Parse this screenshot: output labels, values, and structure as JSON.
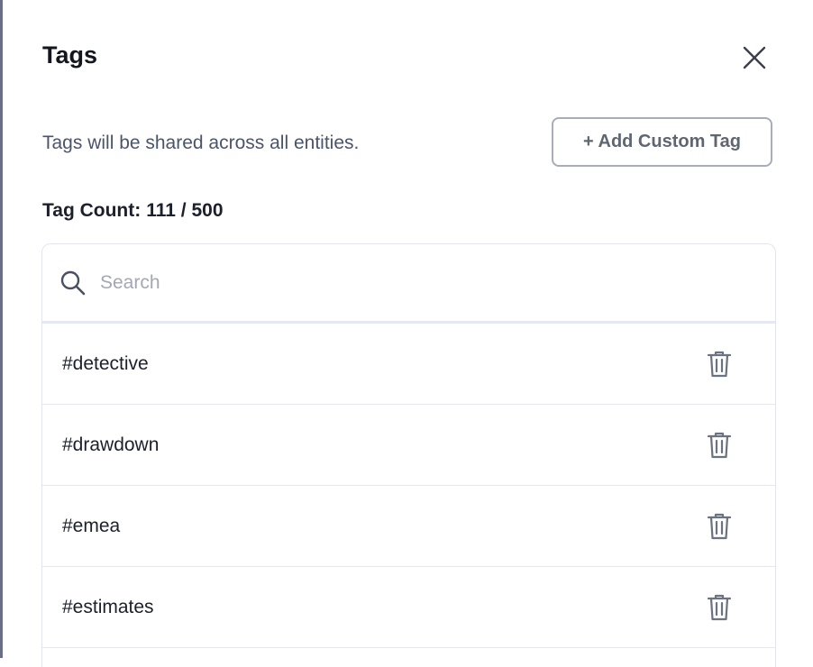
{
  "header": {
    "title": "Tags",
    "close_icon": "close-icon"
  },
  "subtitle": "Tags will be shared across all entities.",
  "add_button": {
    "label": "+ Add Custom Tag"
  },
  "tag_count": {
    "label": "Tag Count:",
    "value": "111 / 500"
  },
  "search": {
    "placeholder": "Search",
    "value": "",
    "icon": "search-icon"
  },
  "tags": [
    {
      "label": "#detective",
      "icon": "trash-icon"
    },
    {
      "label": "#drawdown",
      "icon": "trash-icon"
    },
    {
      "label": "#emea",
      "icon": "trash-icon"
    },
    {
      "label": "#estimates",
      "icon": "trash-icon"
    }
  ],
  "colors": {
    "icon": "#6b7280",
    "border": "#e3e5ea",
    "text_primary": "#1c202b",
    "text_secondary": "#4b5568",
    "left_edge": "#6b6f86"
  }
}
